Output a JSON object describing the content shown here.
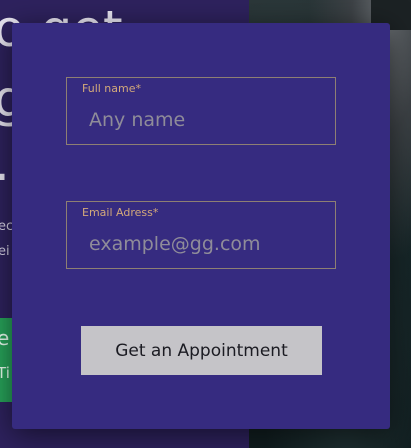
{
  "background": {
    "hero_lines": [
      "o get",
      "g",
      "."
    ],
    "text_lines": [
      "ec",
      "ei"
    ],
    "cta": {
      "line1": "e",
      "line2": "Ti"
    }
  },
  "form": {
    "name_field": {
      "label": "Full name*",
      "placeholder": "Any name",
      "value": ""
    },
    "email_field": {
      "label": "Email Adress*",
      "placeholder": "example@gg.com",
      "value": ""
    },
    "submit_label": "Get an Appointment"
  },
  "colors": {
    "modal_bg": "#362b80",
    "field_label": "#d3a97a",
    "button_bg": "#c5c4c8"
  }
}
